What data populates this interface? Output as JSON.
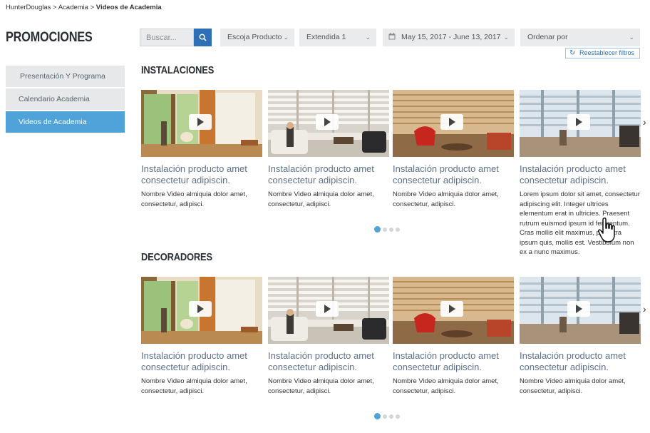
{
  "breadcrumb": {
    "item1": "HunterDouglas",
    "sep": ">",
    "item2": "Academia",
    "current": "Videos de Academia"
  },
  "page_title": "PROMOCIONES",
  "sidebar": {
    "items": [
      {
        "label": "Presentación Y Programa"
      },
      {
        "label": "Calendario Academia"
      },
      {
        "label": "Videos de Academia"
      }
    ]
  },
  "toolbar": {
    "search_placeholder": "Buscar...",
    "product": "Escoja Producto",
    "extendida": "Extendida 1",
    "date_range": "May 15, 2017 - June 13, 2017",
    "order": "Ordenar por",
    "reset": "Reestablecer filtros"
  },
  "sections": [
    {
      "title": "INSTALACIONES",
      "cards": [
        {
          "title": "Instalación producto amet consectetur adipiscin.",
          "desc": "Nombre Video almiquia dolor amet, consectetur, adipisci."
        },
        {
          "title": "Instalación producto amet consectetur adipiscin.",
          "desc": "Nombre Video almiquia dolor amet, consectetur, adipisci."
        },
        {
          "title": "Instalación producto amet consectetur adipiscin.",
          "desc": "Nombre Video almiquia dolor amet, consectetur, adipisci."
        },
        {
          "title": "Instalación producto amet consectetur adipiscin.",
          "desc": "Lorem ipsum dolor sit amet, consectetur adipiscing elit. Integer ultrices elementum erat in ultricies. Praesent rutrum euismod ipsum id fermentum. Cras mollis elit maximus, pharetra ipsum quis, mollis est. Vestibulum non ex a nunc maximus."
        }
      ]
    },
    {
      "title": "DECORADORES",
      "cards": [
        {
          "title": "Instalación producto amet consectetur adipiscin.",
          "desc": "Nombre Video almiquia dolor amet, consectetur, adipisci."
        },
        {
          "title": "Instalación producto amet consectetur adipiscin.",
          "desc": "Nombre Video almiquia dolor amet, consectetur, adipisci."
        },
        {
          "title": "Instalación producto amet consectetur adipiscin.",
          "desc": "Nombre Video almiquia dolor amet, consectetur, adipisci."
        },
        {
          "title": "Instalación producto amet consectetur adipiscin.",
          "desc": "Nombre Video almiquia dolor amet, consectetur, adipisci."
        }
      ]
    }
  ],
  "icons": {
    "search": "search-icon",
    "calendar": "calendar-icon",
    "refresh": "refresh-icon",
    "play": "play-icon",
    "next": "chevron-right-icon",
    "cursor": "hand-pointer-icon"
  },
  "colors": {
    "accent": "#4fa3d8",
    "search_button": "#2d70b5",
    "card_title": "#5e7189"
  }
}
